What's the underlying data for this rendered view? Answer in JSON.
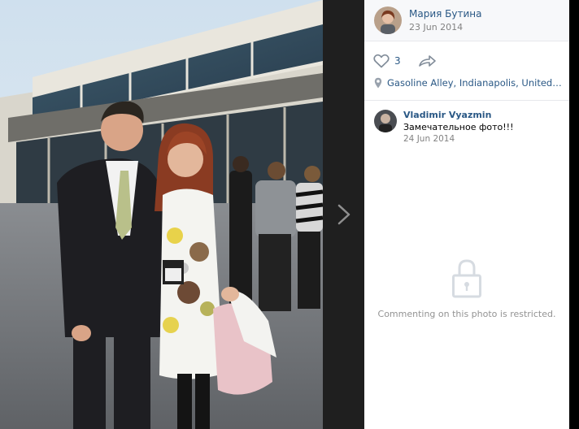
{
  "post": {
    "author": "Мария Бутина",
    "date": "23 Jun 2014",
    "likes": "3",
    "location": "Gasoline Alley, Indianapolis, United States"
  },
  "comments": [
    {
      "author": "Vladimir Vyazmin",
      "text": "Замечательное фото!!!",
      "date": "24 Jun 2014"
    }
  ],
  "restricted_notice": "Commenting on this photo is restricted.",
  "icons": {
    "like": "heart-icon",
    "share": "share-arrow-icon",
    "location": "location-pin-icon",
    "lock": "lock-icon",
    "next": "chevron-right-icon"
  },
  "colors": {
    "link": "#2a5885",
    "muted": "#828282",
    "panel_bg": "#ffffff",
    "header_bg": "#f7f8fa"
  }
}
